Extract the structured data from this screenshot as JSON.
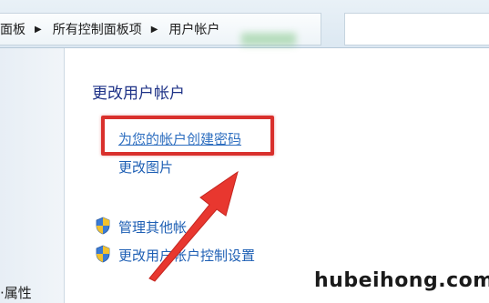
{
  "breadcrumb": {
    "items": [
      "面板",
      "所有控制面板项",
      "用户帐户"
    ]
  },
  "left_pane": {
    "partial_label": "·属性"
  },
  "main": {
    "title": "更改用户帐户",
    "links": {
      "create_password": "为您的帐户创建密码",
      "change_picture": "更改图片",
      "manage_accounts": "管理其他帐",
      "uac_settings": "更改用户帐户控制设置"
    }
  },
  "annotation": {
    "highlight_color": "#d9302c",
    "arrow_color": "#e8372f"
  },
  "watermark": "hubeihong.com",
  "icons": {
    "shield": "uac-shield-icon",
    "separator": "breadcrumb-triangle"
  }
}
